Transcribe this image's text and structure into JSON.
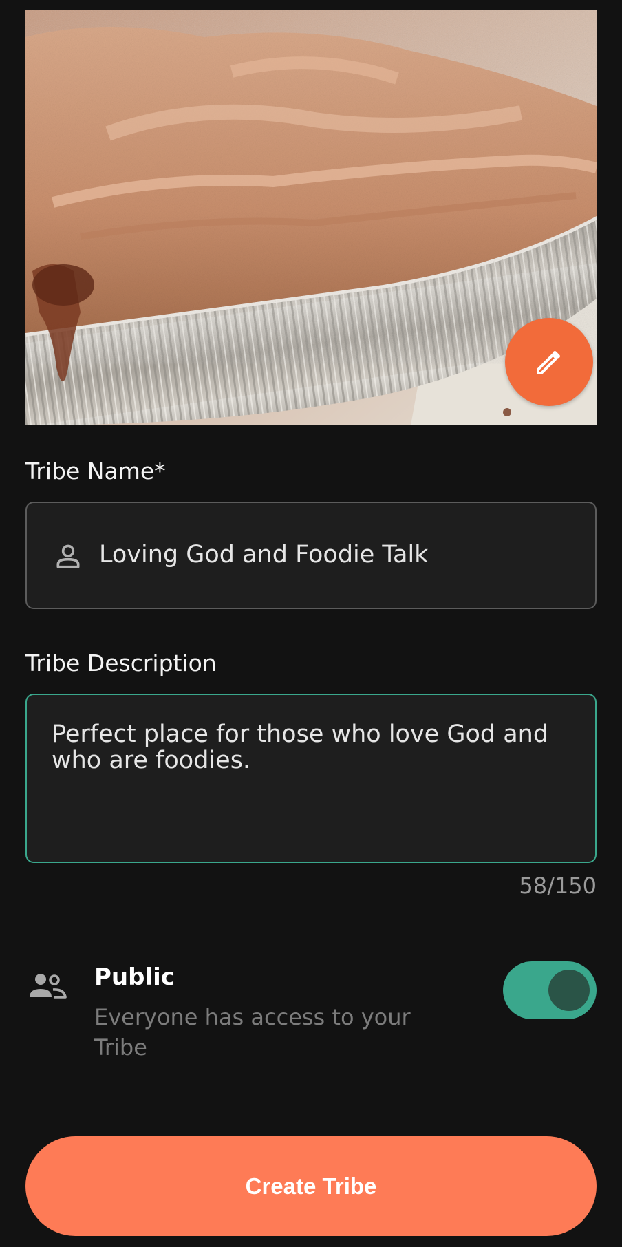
{
  "cover": {
    "image_alt": "Close-up of a baked pie in an aluminum tin",
    "edit_icon": "pencil-icon",
    "accent": "#f26b3a"
  },
  "tribe_name": {
    "label": "Tribe Name*",
    "icon": "person-icon",
    "value": "Loving God and Foodie Talk"
  },
  "tribe_description": {
    "label": "Tribe Description",
    "value": "Perfect place for those who love God and who are foodies.",
    "counter": "58/150",
    "focus_color": "#3aa78c"
  },
  "visibility": {
    "icon": "group-icon",
    "title": "Public",
    "description": "Everyone has access to your Tribe",
    "enabled": true,
    "toggle_color": "#3aa78c"
  },
  "create_button": {
    "label": "Create Tribe",
    "color": "#fe7b56"
  }
}
